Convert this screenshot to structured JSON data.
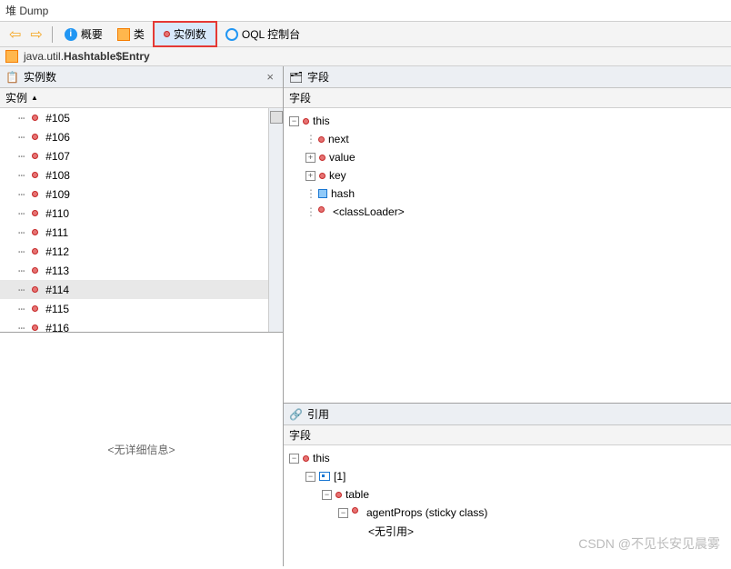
{
  "title": "堆 Dump",
  "toolbar": {
    "summary": "概要",
    "classes": "类",
    "instances": "实例数",
    "oql": "OQL 控制台"
  },
  "classpath": {
    "prefix": "java.util.",
    "bold": "Hashtable$Entry"
  },
  "left": {
    "pane_title": "实例数",
    "col_header": "实例",
    "detail_placeholder": "<无详细信息>",
    "items": [
      {
        "label": "#105"
      },
      {
        "label": "#106"
      },
      {
        "label": "#107"
      },
      {
        "label": "#108"
      },
      {
        "label": "#109"
      },
      {
        "label": "#110"
      },
      {
        "label": "#111"
      },
      {
        "label": "#112"
      },
      {
        "label": "#113"
      },
      {
        "label": "#114"
      },
      {
        "label": "#115"
      },
      {
        "label": "#116"
      }
    ],
    "selected_index": 9
  },
  "fields": {
    "pane_title": "字段",
    "col_header": "字段",
    "this": "this",
    "children": {
      "next": "next",
      "value": "value",
      "key": "key",
      "hash": "hash",
      "classLoader": "<classLoader>"
    }
  },
  "refs": {
    "pane_title": "引用",
    "col_header": "字段",
    "this": "this",
    "array": "[1]",
    "table": "table",
    "agentProps": "agentProps (sticky class)",
    "noref": "<无引用>"
  },
  "watermark": "CSDN @不见长安见晨雾"
}
